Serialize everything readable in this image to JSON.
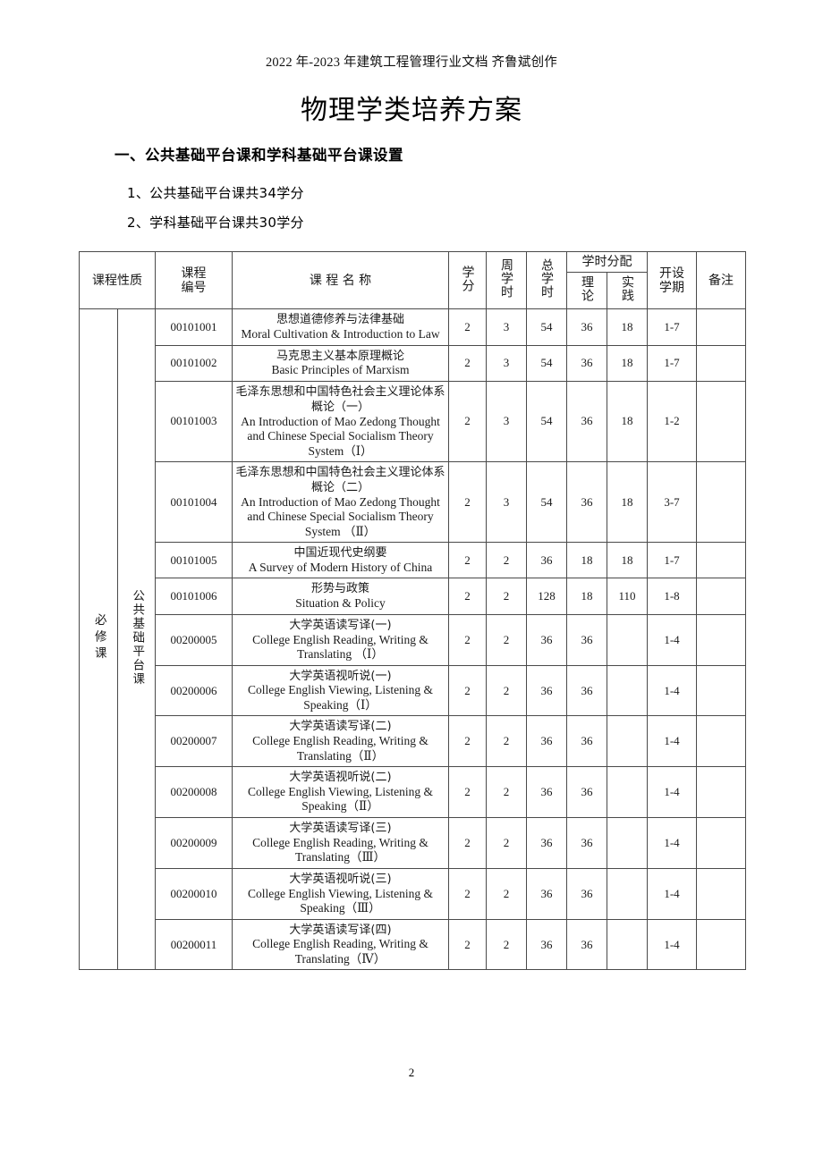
{
  "header": {
    "running_head": "2022 年-2023 年建筑工程管理行业文档 齐鲁斌创作",
    "title": "物理学类培养方案"
  },
  "sections": {
    "heading_1": "一、公共基础平台课和学科基础平台课设置",
    "item_1": "1、公共基础平台课共34学分",
    "item_2": "2、学科基础平台课共30学分"
  },
  "table": {
    "headers": {
      "course_nature": "课程性质",
      "course_code_line1": "课程",
      "course_code_line2": "编号",
      "course_name": "课 程 名 称",
      "credits": "学分",
      "weekly_hours": "周学时",
      "total_hours": "总学时",
      "hours_allocation": "学时分配",
      "theory": "理论",
      "practice": "实践",
      "term_line1": "开设",
      "term_line2": "学期",
      "remarks": "备注"
    },
    "group_nature": "必修课",
    "group_platform": "公共基础平台课",
    "rows": [
      {
        "code": "00101001",
        "name_cn": "思想道德修养与法律基础",
        "name_en": "Moral Cultivation & Introduction to Law",
        "credits": "2",
        "weekly": "3",
        "total": "54",
        "theory": "36",
        "practice": "18",
        "term": "1-7",
        "remarks": ""
      },
      {
        "code": "00101002",
        "name_cn": "马克思主义基本原理概论",
        "name_en": "Basic Principles of Marxism",
        "credits": "2",
        "weekly": "3",
        "total": "54",
        "theory": "36",
        "practice": "18",
        "term": "1-7",
        "remarks": ""
      },
      {
        "code": "00101003",
        "name_cn": "毛泽东思想和中国特色社会主义理论体系概论（一）",
        "name_en": "An Introduction of Mao Zedong Thought and Chinese Special Socialism Theory System（Ⅰ）",
        "credits": "2",
        "weekly": "3",
        "total": "54",
        "theory": "36",
        "practice": "18",
        "term": "1-2",
        "remarks": ""
      },
      {
        "code": "00101004",
        "name_cn": "毛泽东思想和中国特色社会主义理论体系概论（二）",
        "name_en": "An Introduction of Mao Zedong Thought and Chinese Special Socialism Theory System （Ⅱ）",
        "credits": "2",
        "weekly": "3",
        "total": "54",
        "theory": "36",
        "practice": "18",
        "term": "3-7",
        "remarks": ""
      },
      {
        "code": "00101005",
        "name_cn": "中国近现代史纲要",
        "name_en": "A Survey of Modern History of China",
        "credits": "2",
        "weekly": "2",
        "total": "36",
        "theory": "18",
        "practice": "18",
        "term": "1-7",
        "remarks": ""
      },
      {
        "code": "00101006",
        "name_cn": "形势与政策",
        "name_en": "Situation & Policy",
        "credits": "2",
        "weekly": "2",
        "total": "128",
        "theory": "18",
        "practice": "110",
        "term": "1-8",
        "remarks": ""
      },
      {
        "code": "00200005",
        "name_cn": "大学英语读写译(一)",
        "name_en": "College English Reading, Writing & Translating （Ⅰ）",
        "credits": "2",
        "weekly": "2",
        "total": "36",
        "theory": "36",
        "practice": "",
        "term": "1-4",
        "remarks": ""
      },
      {
        "code": "00200006",
        "name_cn": "大学英语视听说(一)",
        "name_en": "College English Viewing, Listening & Speaking（Ⅰ）",
        "credits": "2",
        "weekly": "2",
        "total": "36",
        "theory": "36",
        "practice": "",
        "term": "1-4",
        "remarks": ""
      },
      {
        "code": "00200007",
        "name_cn": "大学英语读写译(二)",
        "name_en": "College English Reading, Writing & Translating（Ⅱ）",
        "credits": "2",
        "weekly": "2",
        "total": "36",
        "theory": "36",
        "practice": "",
        "term": "1-4",
        "remarks": ""
      },
      {
        "code": "00200008",
        "name_cn": "大学英语视听说(二)",
        "name_en": "College English Viewing, Listening & Speaking（Ⅱ）",
        "credits": "2",
        "weekly": "2",
        "total": "36",
        "theory": "36",
        "practice": "",
        "term": "1-4",
        "remarks": ""
      },
      {
        "code": "00200009",
        "name_cn": "大学英语读写译(三)",
        "name_en": "College English Reading, Writing & Translating（Ⅲ）",
        "credits": "2",
        "weekly": "2",
        "total": "36",
        "theory": "36",
        "practice": "",
        "term": "1-4",
        "remarks": ""
      },
      {
        "code": "00200010",
        "name_cn": "大学英语视听说(三)",
        "name_en": "College English Viewing, Listening & Speaking（Ⅲ）",
        "credits": "2",
        "weekly": "2",
        "total": "36",
        "theory": "36",
        "practice": "",
        "term": "1-4",
        "remarks": ""
      },
      {
        "code": "00200011",
        "name_cn": "大学英语读写译(四)",
        "name_en": "College English Reading, Writing & Translating（Ⅳ）",
        "credits": "2",
        "weekly": "2",
        "total": "36",
        "theory": "36",
        "practice": "",
        "term": "1-4",
        "remarks": ""
      }
    ]
  },
  "footer": {
    "page_number": "2"
  }
}
